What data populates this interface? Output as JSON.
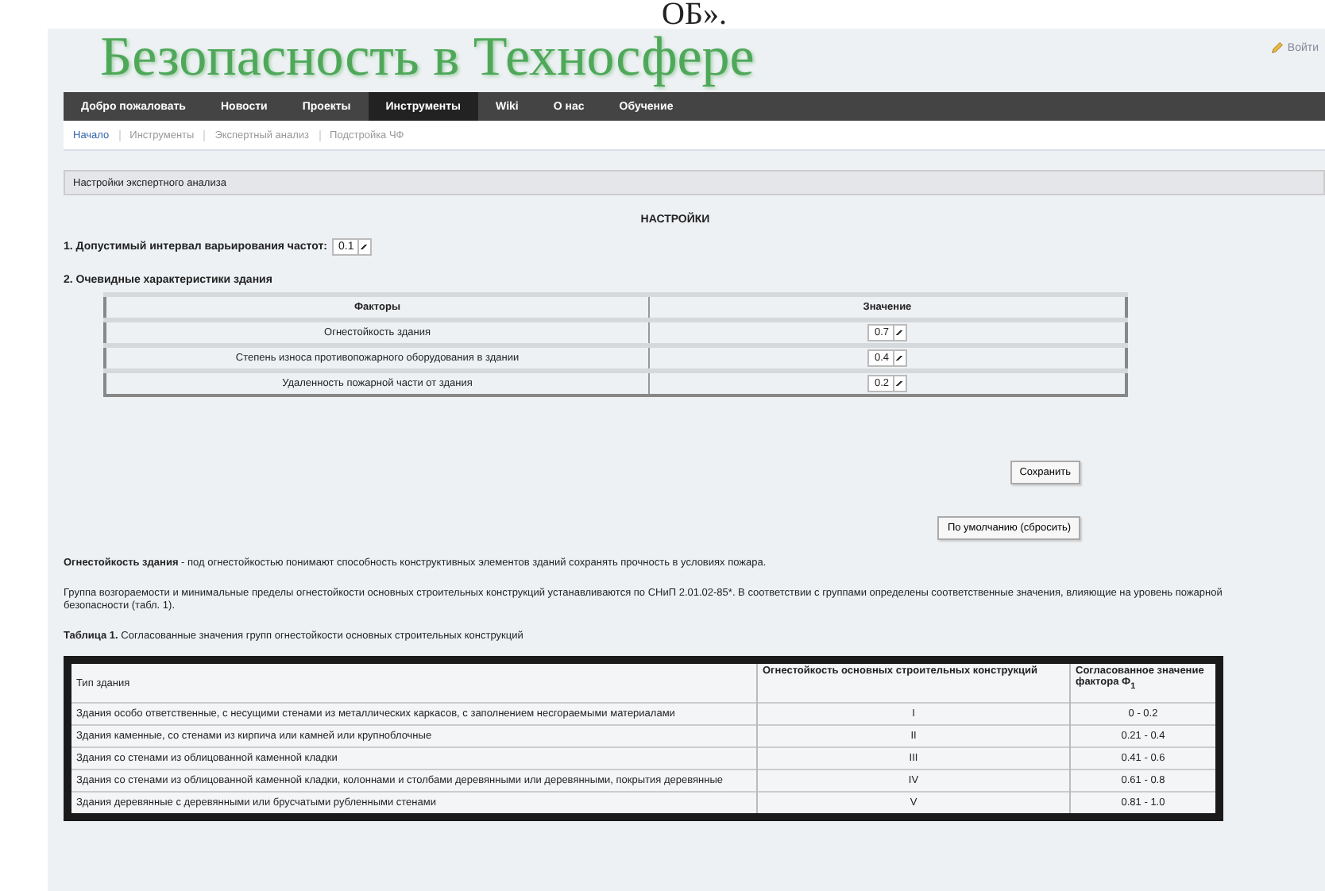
{
  "top_fragment": "ОБ».",
  "site_title": "Безопасность в Техносфере",
  "login_link": "Войти",
  "nav": [
    {
      "label": "Добро пожаловать",
      "selected": false
    },
    {
      "label": "Новости",
      "selected": false
    },
    {
      "label": "Проекты",
      "selected": false
    },
    {
      "label": "Инструменты",
      "selected": true
    },
    {
      "label": "Wiki",
      "selected": false
    },
    {
      "label": "О нас",
      "selected": false
    },
    {
      "label": "Обучение",
      "selected": false
    }
  ],
  "breadcrumbs": [
    {
      "label": "Начало",
      "selected": true
    },
    {
      "label": "Инструменты",
      "selected": false
    },
    {
      "label": "Экспертный анализ",
      "selected": false
    },
    {
      "label": "Подстройка ЧФ",
      "selected": false
    }
  ],
  "panel_title": "Настройки экспертного анализа",
  "heading": "НАСТРОЙКИ",
  "interval_label": "1. Допустимый интервал варьирования частот:",
  "interval_value": "0.1",
  "characteristics_label": "2. Очевидные характеристики здания",
  "factors_table": {
    "columns": [
      "Факторы",
      "Значение"
    ],
    "rows": [
      {
        "factor": "Огнестойкость здания",
        "value": "0.7"
      },
      {
        "factor": "Степень износа противопожарного оборудования в здании",
        "value": "0.4"
      },
      {
        "factor": "Удаленность пожарной части от здания",
        "value": "0.2"
      }
    ]
  },
  "save_button": "Сохранить",
  "default_button": "По умолчанию (сбросить)",
  "definition": "**Огнестойкость здания** - под огнестойкостью понимают способность конструктивных элементов зданий сохранять прочность в условиях пожара.",
  "explanation": "Группа возгораемости и минимальные пределы огнестойкости основных строительных конструкций устанавливаются по СНиП 2.01.02-85*. В соответствии с группами определены соответственные значения, влияющие на уровень пожарной безопасности (табл. 1).",
  "table_caption": "**Таблица 1.** Согласованные значения групп огнестойкости основных строительных конструкций",
  "groups_table": {
    "columns": [
      "Тип здания",
      "Огнестойкость основных строительных конструкций",
      "Согласованное значение фактора Ф$_{1}$"
    ],
    "rows": [
      {
        "type": "Здания особо ответственные, с несущими стенами из металлических каркасов, с заполнением несгораемыми материалами",
        "group": "I",
        "range": "0 - 0.2"
      },
      {
        "type": "Здания каменные, со стенами из кирпича или камней или крупноблочные",
        "group": "II",
        "range": "0.21 - 0.4"
      },
      {
        "type": "Здания со стенами из облицованной каменной кладки",
        "group": "III",
        "range": "0.41 - 0.6"
      },
      {
        "type": "Здания со стенами из облицованной каменной кладки, колоннами и столбами деревянными или деревянными, покрытия деревянные",
        "group": "IV",
        "range": "0.61 - 0.8"
      },
      {
        "type": "Здания деревянные с деревянными или брусчатыми рубленными стенами",
        "group": "V",
        "range": "0.81 - 1.0"
      }
    ]
  }
}
